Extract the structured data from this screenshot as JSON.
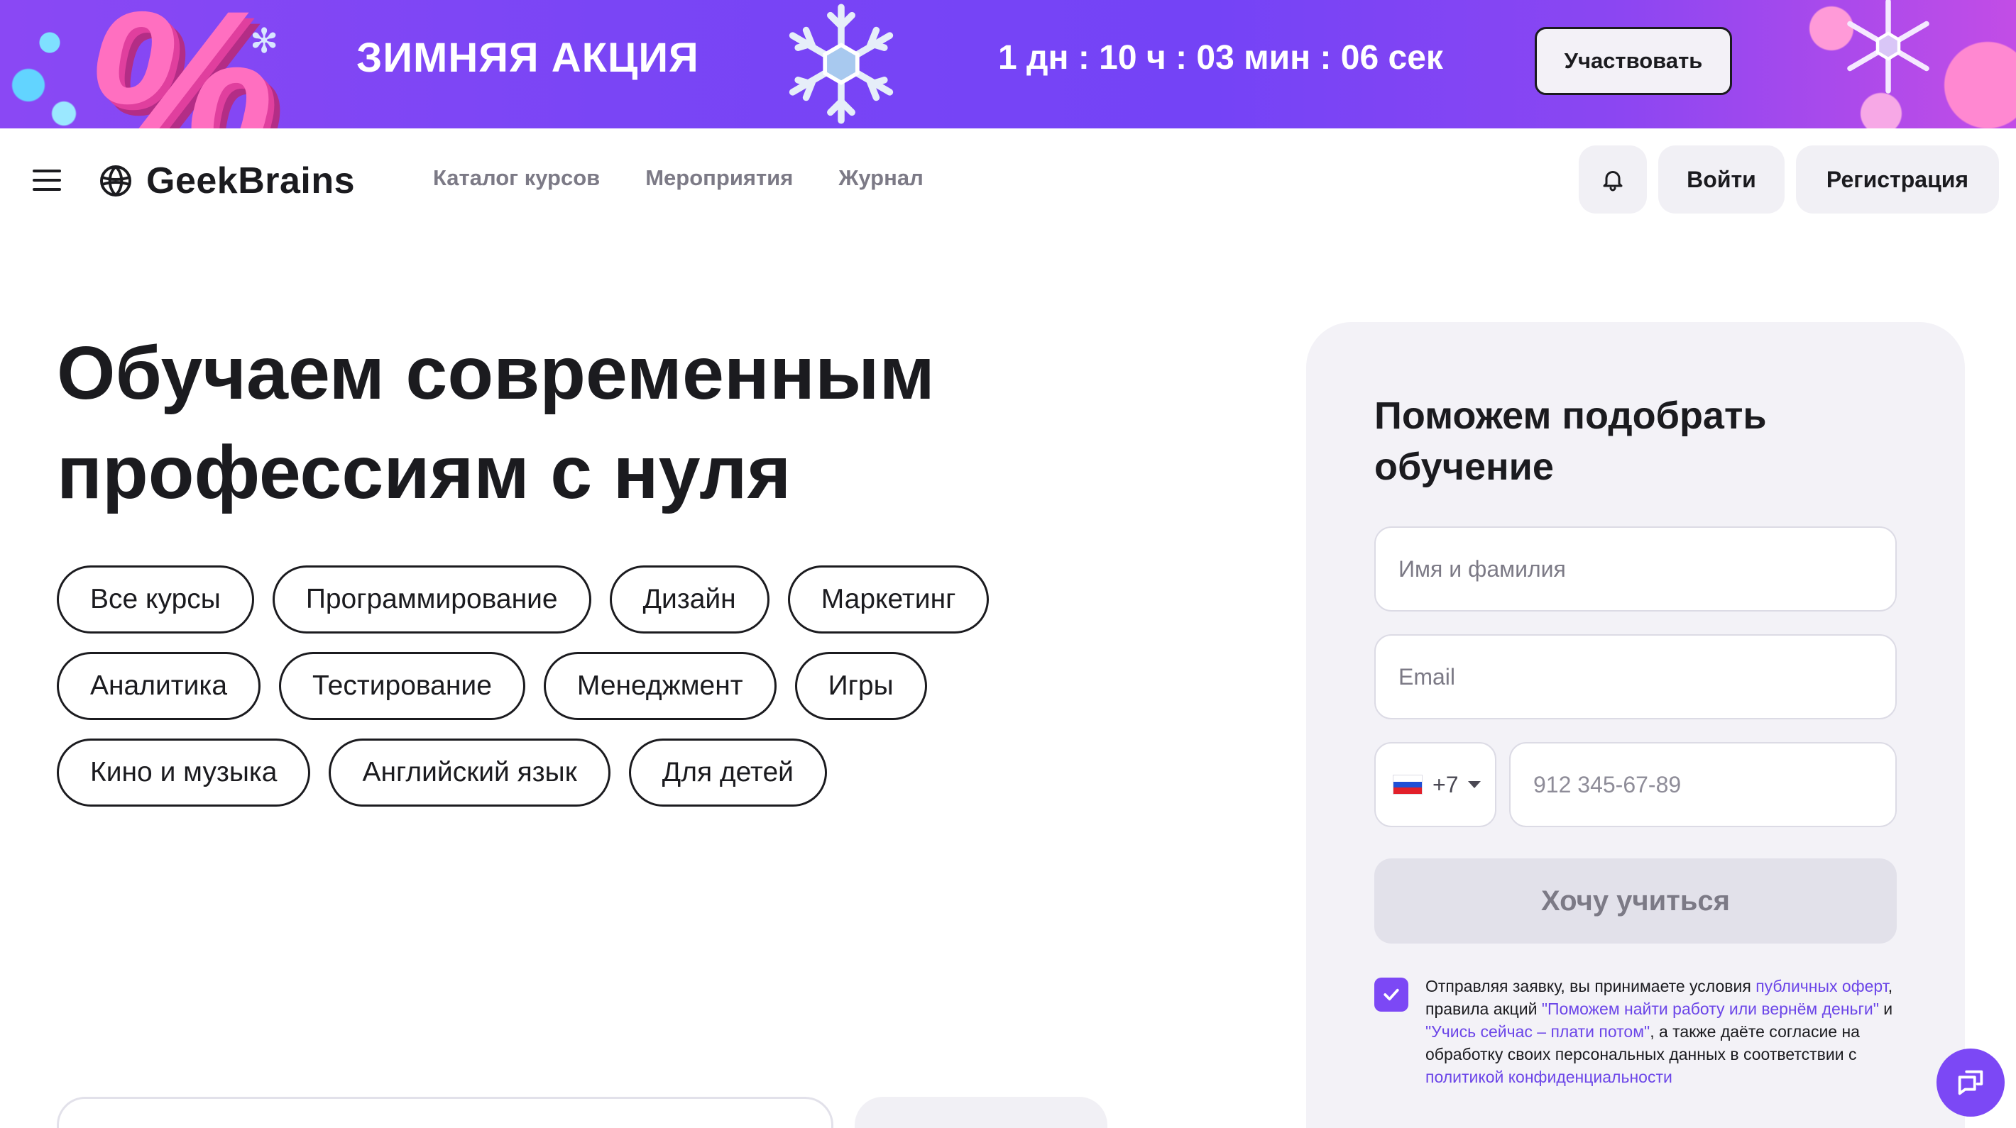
{
  "banner": {
    "title": "ЗИМНЯЯ АКЦИЯ",
    "timer": "1 дн : 10 ч : 03 мин : 06 сек",
    "cta": "Участвовать",
    "percent_glyph": "%",
    "colors": {
      "bg_start": "#8a48f4",
      "bg_end": "#c24de6",
      "accent_pink": "#ff6fc0"
    }
  },
  "header": {
    "logo_text": "GeekBrains",
    "nav": [
      "Каталог курсов",
      "Мероприятия",
      "Журнал"
    ],
    "login": "Войти",
    "register": "Регистрация",
    "icons": {
      "menu": "hamburger-icon",
      "bell": "bell-icon",
      "logo": "brain-logo-icon"
    }
  },
  "hero": {
    "title_line1": "Обучаем современным",
    "title_line2": "профессиям с нуля",
    "chip_rows": [
      [
        "Все курсы",
        "Программирование",
        "Дизайн",
        "Маркетинг"
      ],
      [
        "Аналитика",
        "Тестирование",
        "Менеджмент",
        "Игры"
      ],
      [
        "Кино и музыка",
        "Английский язык",
        "Для детей"
      ]
    ]
  },
  "form": {
    "title": "Поможем подобрать обучение",
    "name_placeholder": "Имя и фамилия",
    "email_placeholder": "Email",
    "phone_code": "+7",
    "phone_placeholder": "912 345-67-89",
    "submit": "Хочу учиться",
    "consent_checked": true,
    "consent": {
      "t1": "Отправляя заявку, вы принимаете условия ",
      "l1": "публичных оферт",
      "t2": ", правила акций ",
      "l2": "\"Поможем найти работу или вернём деньги\"",
      "t3": " и ",
      "l3": "\"Учись сейчас – плати потом\"",
      "t4": ", а также даёте согласие на обработку своих персональных данных в соответствии с ",
      "l4": "политикой конфиденциальности"
    },
    "colors": {
      "accent": "#7c48f5",
      "link": "#6b45e8"
    }
  },
  "chat": {
    "icon": "chat-bubbles-icon"
  }
}
